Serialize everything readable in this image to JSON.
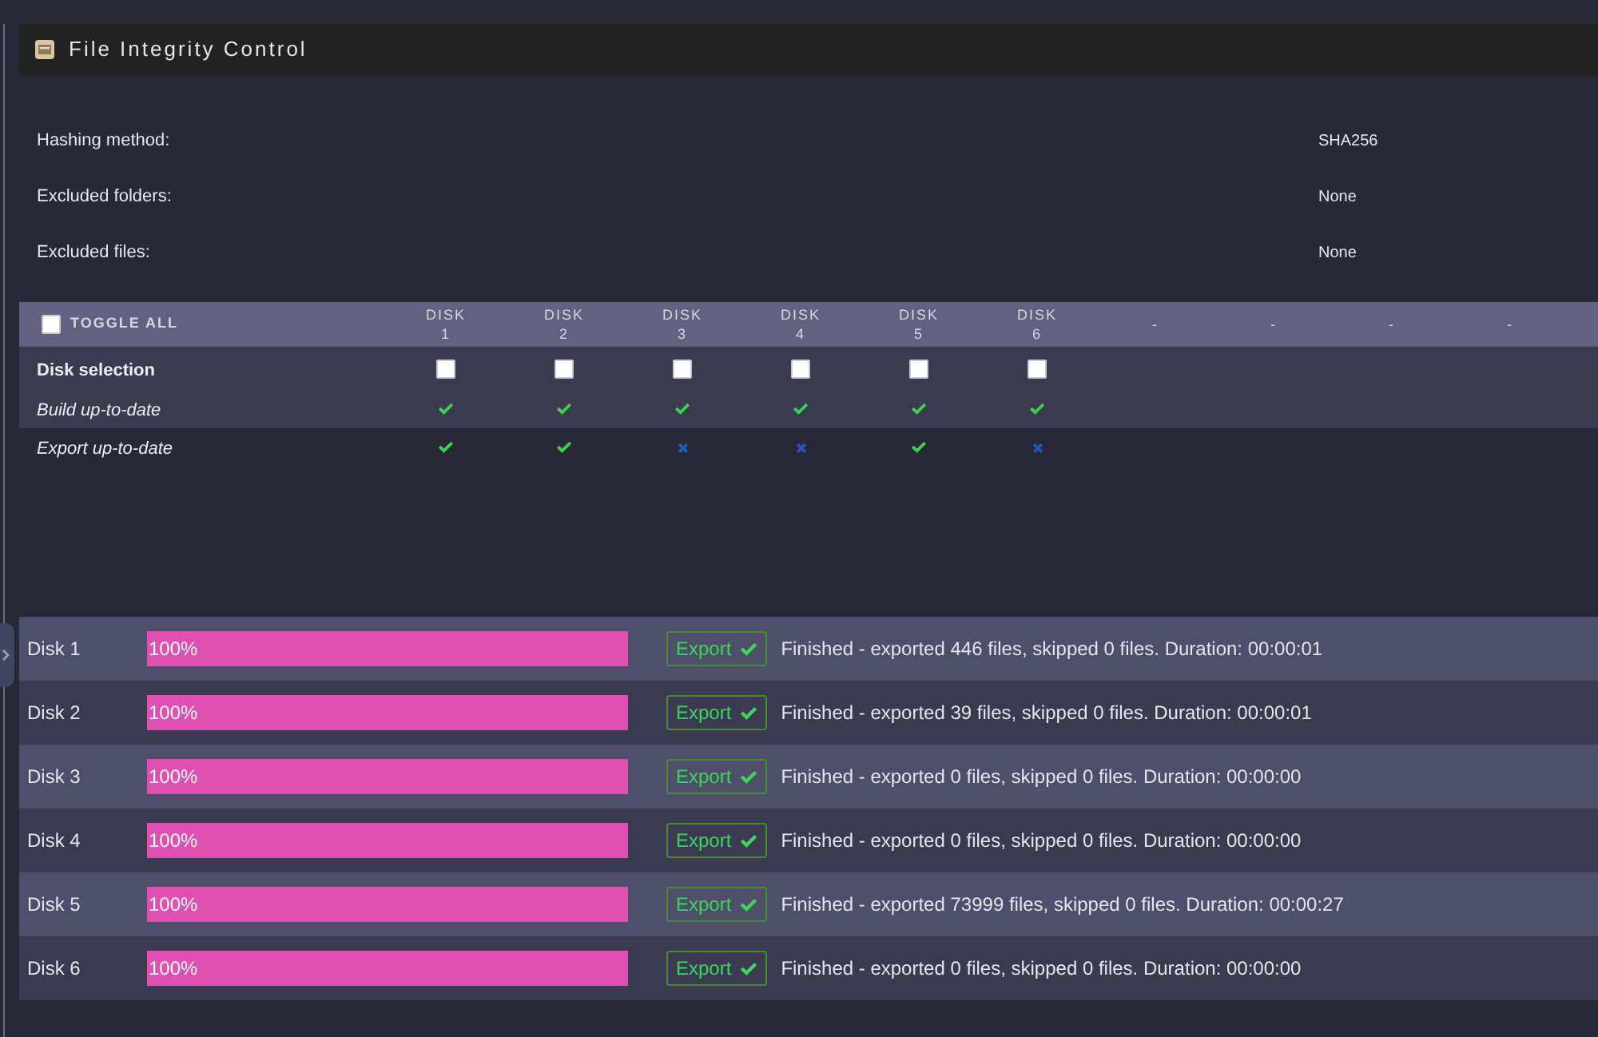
{
  "header": {
    "title": "File Integrity Control"
  },
  "settings": [
    {
      "label": "Hashing method:",
      "value": "SHA256"
    },
    {
      "label": "Excluded folders:",
      "value": "None"
    },
    {
      "label": "Excluded files:",
      "value": "None"
    }
  ],
  "disk_table": {
    "toggle_all": {
      "label": "TOGGLE ALL",
      "checked": false
    },
    "columns": [
      "DISK 1",
      "DISK 2",
      "DISK 3",
      "DISK 4",
      "DISK 5",
      "DISK 6",
      "-",
      "-",
      "-",
      "-"
    ],
    "rows": [
      {
        "kind": "checkbox",
        "label": "Disk selection",
        "cells": [
          {
            "checked": false
          },
          {
            "checked": false
          },
          {
            "checked": false
          },
          {
            "checked": false
          },
          {
            "checked": false
          },
          {
            "checked": false
          }
        ]
      },
      {
        "kind": "status",
        "label": "Build up-to-date",
        "cells": [
          {
            "ok": true
          },
          {
            "ok": true
          },
          {
            "ok": true
          },
          {
            "ok": true
          },
          {
            "ok": true
          },
          {
            "ok": true
          }
        ]
      },
      {
        "kind": "status",
        "label": "Export up-to-date",
        "cells": [
          {
            "ok": true
          },
          {
            "ok": true
          },
          {
            "ok": false
          },
          {
            "ok": false
          },
          {
            "ok": true
          },
          {
            "ok": false
          }
        ]
      }
    ]
  },
  "disks": [
    {
      "name": "Disk 1",
      "level": 1,
      "progress_label": "100%",
      "button": {
        "label": "Export",
        "done": true
      },
      "status": "Finished - exported 446 files, skipped 0 files. Duration: 00:00:01"
    },
    {
      "name": "Disk 2",
      "level": 1,
      "progress_label": "100%",
      "button": {
        "label": "Export",
        "done": true
      },
      "status": "Finished - exported 39 files, skipped 0 files. Duration: 00:00:01"
    },
    {
      "name": "Disk 3",
      "level": 1,
      "progress_label": "100%",
      "button": {
        "label": "Export",
        "done": true
      },
      "status": "Finished - exported 0 files, skipped 0 files. Duration: 00:00:00"
    },
    {
      "name": "Disk 4",
      "level": 1,
      "progress_label": "100%",
      "button": {
        "label": "Export",
        "done": true
      },
      "status": "Finished - exported 0 files, skipped 0 files. Duration: 00:00:00"
    },
    {
      "name": "Disk 5",
      "level": 1,
      "progress_label": "100%",
      "button": {
        "label": "Export",
        "done": true
      },
      "status": "Finished - exported 73999 files, skipped 0 files. Duration: 00:00:27"
    },
    {
      "name": "Disk 6",
      "level": 1,
      "progress_label": "100%",
      "button": {
        "label": "Export",
        "done": true
      },
      "status": "Finished - exported 0 files, skipped 0 files. Duration: 00:00:00"
    }
  ]
}
